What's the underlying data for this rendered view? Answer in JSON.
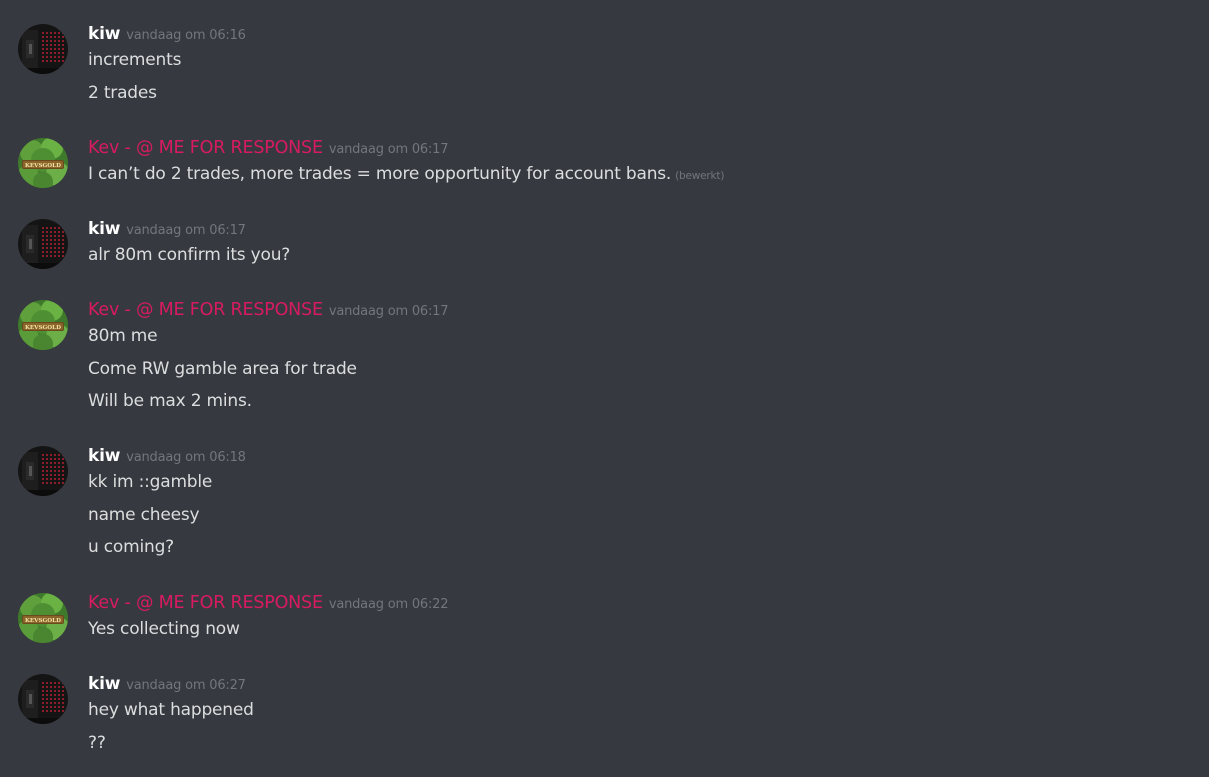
{
  "messages": [
    {
      "author": "kiw",
      "author_type": "kiw",
      "timestamp": "vandaag om 06:16",
      "lines": [
        {
          "text": "increments"
        },
        {
          "text": "2 trades"
        }
      ]
    },
    {
      "author": "Kev - @ ME FOR RESPONSE",
      "author_type": "kev",
      "timestamp": "vandaag om 06:17",
      "lines": [
        {
          "text": "I can’t do 2 trades, more trades = more opportunity for account bans.",
          "edited": "(bewerkt)"
        }
      ]
    },
    {
      "author": "kiw",
      "author_type": "kiw",
      "timestamp": "vandaag om 06:17",
      "lines": [
        {
          "text": "alr 80m confirm its you?"
        }
      ]
    },
    {
      "author": "Kev - @ ME FOR RESPONSE",
      "author_type": "kev",
      "timestamp": "vandaag om 06:17",
      "lines": [
        {
          "text": "80m me"
        },
        {
          "text": "Come RW gamble area for trade"
        },
        {
          "text": "Will be max 2 mins."
        }
      ]
    },
    {
      "author": "kiw",
      "author_type": "kiw",
      "timestamp": "vandaag om 06:18",
      "lines": [
        {
          "text": "kk im ::gamble"
        },
        {
          "text": "name cheesy"
        },
        {
          "text": "u coming?"
        }
      ]
    },
    {
      "author": "Kev - @ ME FOR RESPONSE",
      "author_type": "kev",
      "timestamp": "vandaag om 06:22",
      "lines": [
        {
          "text": "Yes collecting now"
        }
      ]
    },
    {
      "author": "kiw",
      "author_type": "kiw",
      "timestamp": "vandaag om 06:27",
      "lines": [
        {
          "text": "hey what happened"
        },
        {
          "text": "??"
        }
      ]
    }
  ],
  "avatars": {
    "kev_logo_text": "KEVSGOLD"
  },
  "colors": {
    "background": "#36393f",
    "kev_name": "#d81b60",
    "kiw_name": "#ffffff",
    "timestamp": "#72767d",
    "text": "#dcddde"
  }
}
